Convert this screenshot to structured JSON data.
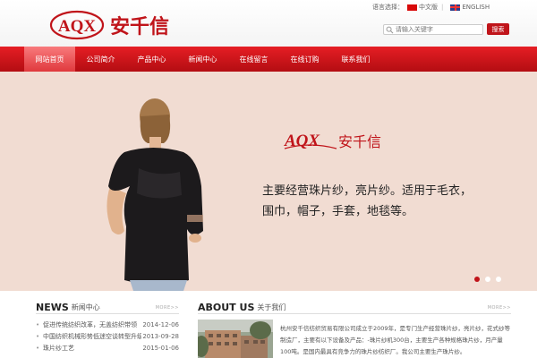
{
  "header": {
    "logo_text": "AQX",
    "logo_cn": "安千信",
    "lang_label": "语言选择：",
    "lang_cn": "中文版",
    "lang_en": "ENGLISH",
    "search_placeholder": "请输入关键字",
    "search_button": "搜索"
  },
  "nav": [
    {
      "label": "网站首页",
      "active": true
    },
    {
      "label": "公司简介"
    },
    {
      "label": "产品中心"
    },
    {
      "label": "新闻中心"
    },
    {
      "label": "在线留言"
    },
    {
      "label": "在线订购"
    },
    {
      "label": "联系我们"
    }
  ],
  "banner": {
    "logo_text": "AQX",
    "logo_cn": "安千信",
    "slogan": [
      "主要经营珠片纱，亮片纱。适用于毛衣，",
      "围巾，帽子，手套，地毯等。"
    ],
    "slides": 3,
    "active_slide": 1
  },
  "news": {
    "title_en": "NEWS",
    "title_cn": "新闻中心",
    "more": "MORE>>",
    "items": [
      {
        "title": "促进传统纺织改革，无盖纺织带领",
        "date": "2014-12-06"
      },
      {
        "title": "中国纺织机械形势低迷空谈转型升级",
        "date": "2013-09-28"
      },
      {
        "title": "珠片纱工艺",
        "date": "2015-01-06"
      }
    ]
  },
  "about": {
    "title_en": "ABOUT US",
    "title_cn": "关于我们",
    "more": "MORE>>",
    "text": "杭州安千信纺织贸易有限公司成立于2009年，是专门生产经营珠片纱，亮片纱，花式纱等制造厂，主要有以下设备及产品：-珠片纱机300台，主要生产各种规格珠片纱，月产量100吨。是国内最具有竞争力的珠片纱纺织厂。我公司主要生产珠片纱。"
  },
  "colors": {
    "brand_red": "#c0141a",
    "banner_bg": "#f1dcd2"
  }
}
